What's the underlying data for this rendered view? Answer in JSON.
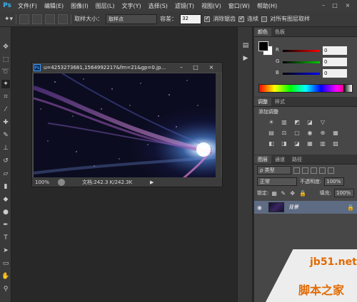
{
  "app": {
    "logo": "Ps"
  },
  "menu": [
    "文件(F)",
    "编辑(E)",
    "图像(I)",
    "图层(L)",
    "文字(Y)",
    "选择(S)",
    "滤镜(T)",
    "视图(V)",
    "窗口(W)",
    "帮助(H)"
  ],
  "window_controls": [
    "–",
    "□",
    "×"
  ],
  "options": {
    "sample_size_label": "取样大小：",
    "sample_size_value": "取样点",
    "tolerance_label": "容差：",
    "tolerance_value": "32",
    "antialias_label": "消除锯齿",
    "contiguous_label": "连续",
    "all_layers_label": "对所有图层取样",
    "antialias_checked": true,
    "contiguous_checked": true,
    "all_layers_checked": false
  },
  "document": {
    "title": "u=4253273681,1564992217&fm=21&gp=0.jp...",
    "zoom": "100%",
    "info": "文档:242.3 K/242.3K",
    "controls": [
      "–",
      "□",
      "×"
    ]
  },
  "color_panel": {
    "tabs": [
      "颜色",
      "色板"
    ],
    "channels": [
      {
        "label": "R",
        "value": "0",
        "color": "#ff0000"
      },
      {
        "label": "G",
        "value": "0",
        "color": "#00c000"
      },
      {
        "label": "B",
        "value": "0",
        "color": "#0000ff"
      }
    ]
  },
  "adjustments_panel": {
    "tabs": [
      "调整",
      "样式"
    ],
    "title": "添加调整",
    "icons": [
      "☀",
      "▥",
      "◩",
      "◪",
      "▽",
      "",
      "▤",
      "⚖",
      "▢",
      "◉",
      "⊕",
      "▦",
      "◧",
      "◨",
      "◪",
      "▦",
      "▥",
      "▨"
    ]
  },
  "layers_panel": {
    "tabs": [
      "图层",
      "通道",
      "路径"
    ],
    "kind_label": "ρ 类型",
    "blend_mode": "正常",
    "opacity_label": "不透明度:",
    "opacity_value": "100%",
    "lock_label": "锁定:",
    "fill_label": "填充:",
    "fill_value": "100%",
    "layers": [
      {
        "name": "背景",
        "visible": true,
        "locked": true
      }
    ]
  },
  "watermark": {
    "site": "jb51.net",
    "name": "脚本之家"
  }
}
